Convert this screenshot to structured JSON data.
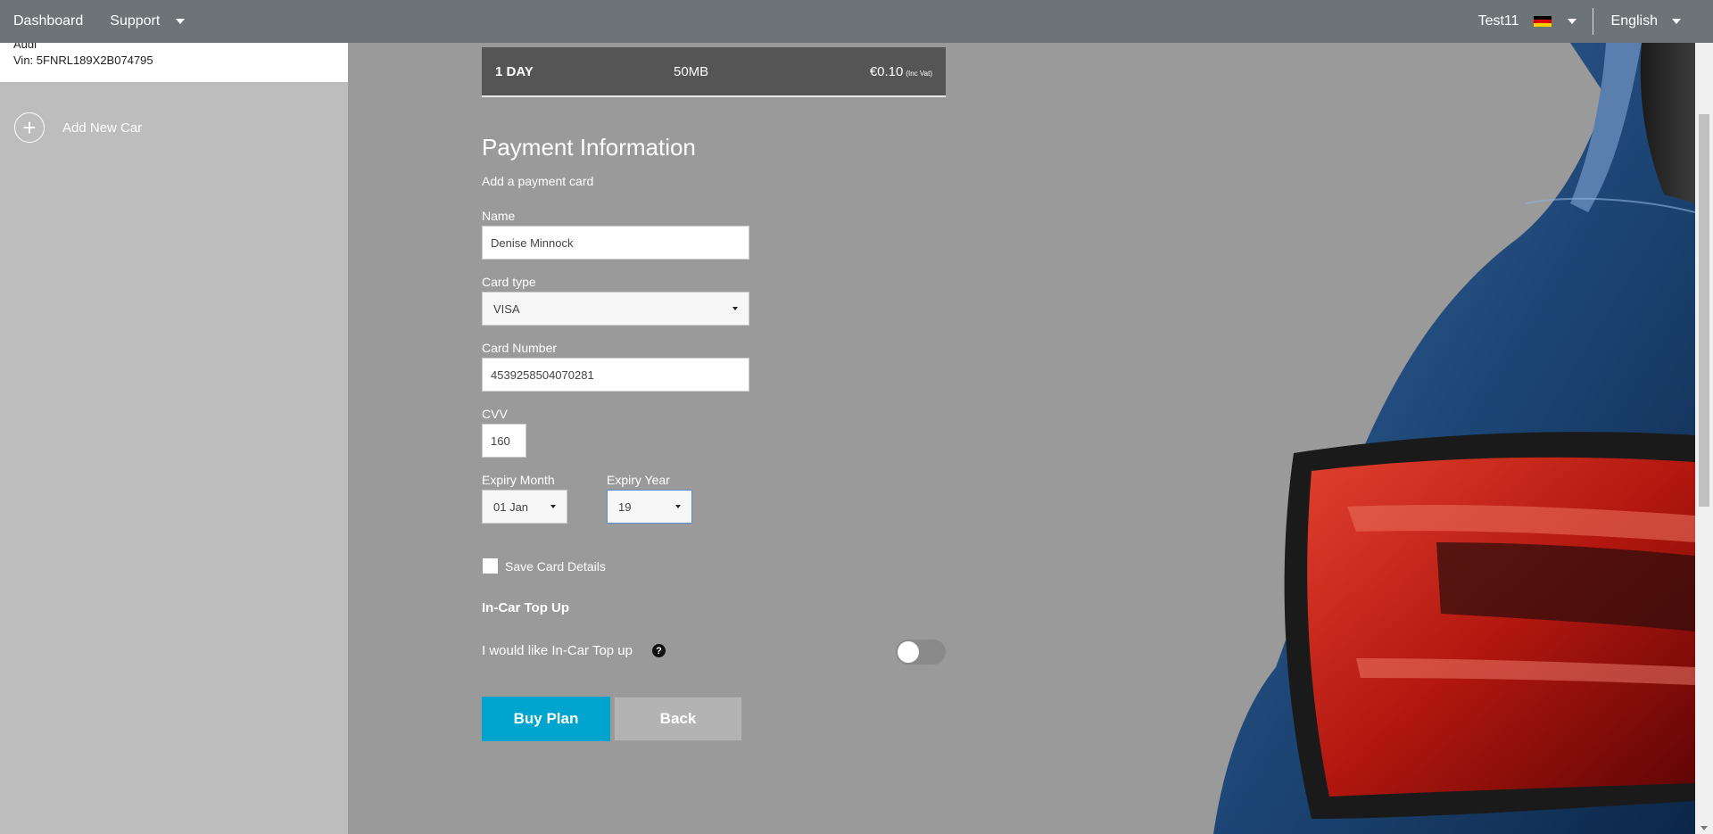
{
  "topbar": {
    "dashboard_label": "Dashboard",
    "support_label": "Support",
    "user_name": "Test11",
    "language": "English"
  },
  "sidebar": {
    "car_make": "Audi",
    "car_vin": "Vin: 5FNRL189X2B074795",
    "add_car_label": "Add New Car"
  },
  "plan": {
    "duration": "1 DAY",
    "data": "50MB",
    "price": "€0.10",
    "vat_note": "(Inc Vat)"
  },
  "payment": {
    "title": "Payment Information",
    "subtitle": "Add a payment card",
    "name_label": "Name",
    "name_value": "Denise Minnock",
    "card_type_label": "Card type",
    "card_type_value": "VISA",
    "card_number_label": "Card Number",
    "card_number_value": "4539258504070281",
    "cvv_label": "CVV",
    "cvv_value": "160",
    "expiry_month_label": "Expiry Month",
    "expiry_month_value": "01 Jan",
    "expiry_year_label": "Expiry Year",
    "expiry_year_value": "19",
    "save_card_label": "Save Card Details",
    "save_card_checked": false
  },
  "topup": {
    "title": "In-Car Top Up",
    "label": "I would like In-Car Top up",
    "help_glyph": "?",
    "enabled": false
  },
  "actions": {
    "buy_label": "Buy Plan",
    "back_label": "Back"
  },
  "colors": {
    "accent": "#00a5cf",
    "topbar": "#6d7478",
    "background": "#9a9a9a"
  }
}
